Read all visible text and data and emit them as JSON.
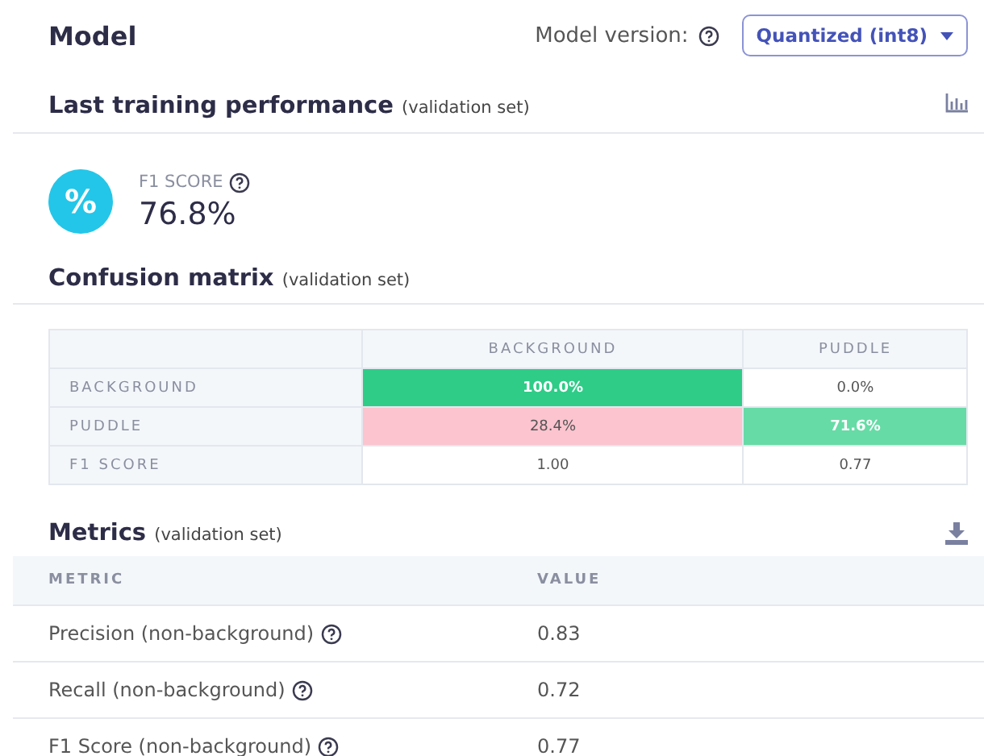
{
  "header": {
    "title": "Model",
    "version_label": "Model version:",
    "version_value": "Quantized (int8)"
  },
  "performance": {
    "title": "Last training performance",
    "subtitle": "(validation set)",
    "score_label": "F1 SCORE",
    "score_value": "76.8%",
    "icon_text": "%"
  },
  "confusion_matrix": {
    "title": "Confusion matrix",
    "subtitle": "(validation set)",
    "columns": [
      "BACKGROUND",
      "PUDDLE"
    ],
    "rows": [
      {
        "label": "BACKGROUND",
        "cells": [
          {
            "text": "100.0%",
            "color": "#2ecc87"
          },
          {
            "text": "0.0%"
          }
        ]
      },
      {
        "label": "PUDDLE",
        "cells": [
          {
            "text": "28.4%",
            "color": "#fbc4cf"
          },
          {
            "text": "71.6%",
            "color": "#66dba6"
          }
        ]
      },
      {
        "label": "F1 SCORE",
        "cells": [
          {
            "text": "1.00"
          },
          {
            "text": "0.77"
          }
        ]
      }
    ]
  },
  "metrics": {
    "title": "Metrics",
    "subtitle": "(validation set)",
    "columns": [
      "METRIC",
      "VALUE"
    ],
    "rows": [
      {
        "metric": "Precision (non-background)",
        "value": "0.83"
      },
      {
        "metric": "Recall (non-background)",
        "value": "0.72"
      },
      {
        "metric": "F1 Score (non-background)",
        "value": "0.77"
      }
    ]
  }
}
